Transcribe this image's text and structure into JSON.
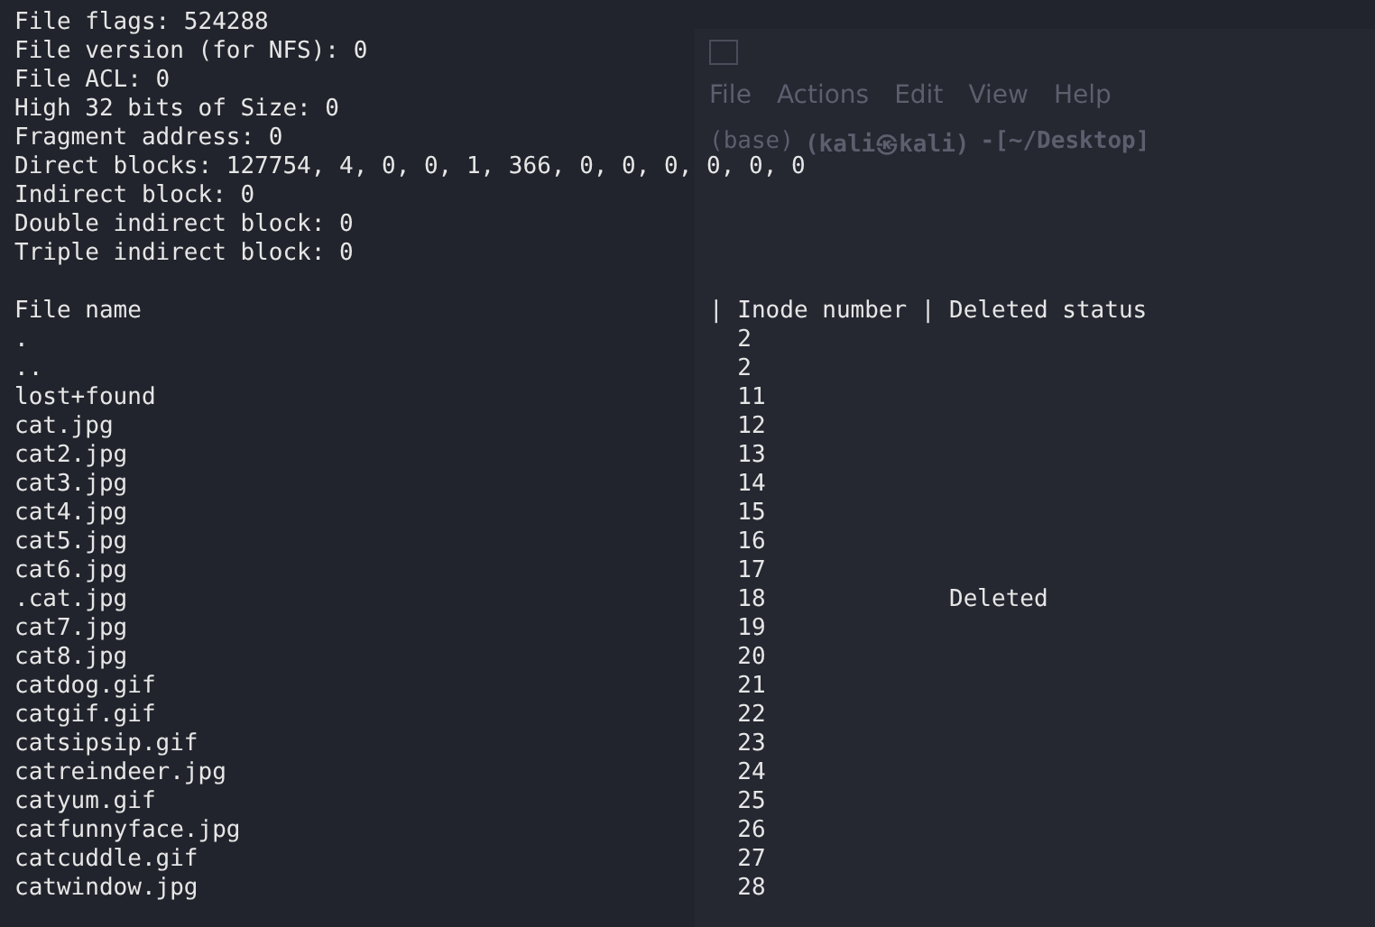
{
  "background_window": {
    "menu": [
      "File",
      "Actions",
      "Edit",
      "View",
      "Help"
    ],
    "prompt": {
      "env": "(base)",
      "user_host": "(kali㉿kali)",
      "path": "-[~/Desktop]"
    }
  },
  "inode_info": [
    "File flags: 524288",
    "File version (for NFS): 0",
    "File ACL: 0",
    "High 32 bits of Size: 0",
    "Fragment address: 0",
    "Direct blocks: 127754, 4, 0, 0, 1, 366, 0, 0, 0, 0, 0, 0",
    "Indirect block: 0",
    "Double indirect block: 0",
    "Triple indirect block: 0"
  ],
  "table": {
    "columns": [
      "File name",
      "| Inode number",
      "| Deleted status"
    ],
    "rows": [
      {
        "name": ".",
        "inode": "2"
      },
      {
        "name": "..",
        "inode": "2"
      },
      {
        "name": "lost+found",
        "inode": "11"
      },
      {
        "name": "cat.jpg",
        "inode": "12"
      },
      {
        "name": "cat2.jpg",
        "inode": "13"
      },
      {
        "name": "cat3.jpg",
        "inode": "14"
      },
      {
        "name": "cat4.jpg",
        "inode": "15"
      },
      {
        "name": "cat5.jpg",
        "inode": "16"
      },
      {
        "name": "cat6.jpg",
        "inode": "17"
      },
      {
        "name": ".cat.jpg",
        "inode": "18",
        "status": "Deleted"
      },
      {
        "name": "cat7.jpg",
        "inode": "19"
      },
      {
        "name": "cat8.jpg",
        "inode": "20"
      },
      {
        "name": "catdog.gif",
        "inode": "21"
      },
      {
        "name": "catgif.gif",
        "inode": "22"
      },
      {
        "name": "catsipsip.gif",
        "inode": "23"
      },
      {
        "name": "catreindeer.jpg",
        "inode": "24"
      },
      {
        "name": "catyum.gif",
        "inode": "25"
      },
      {
        "name": "catfunnyface.jpg",
        "inode": "26"
      },
      {
        "name": "catcuddle.gif",
        "inode": "27"
      },
      {
        "name": "catwindow.jpg",
        "inode": "28"
      }
    ]
  }
}
